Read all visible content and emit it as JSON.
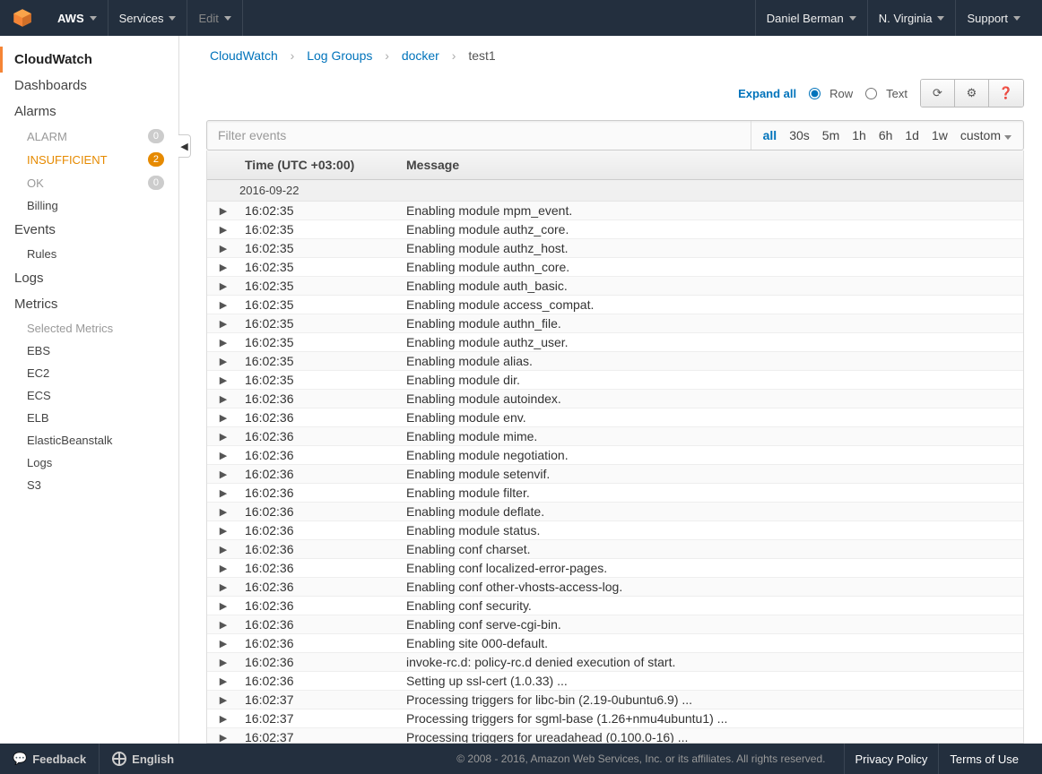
{
  "topnav": {
    "aws": "AWS",
    "services": "Services",
    "edit": "Edit",
    "user": "Daniel Berman",
    "region": "N. Virginia",
    "support": "Support"
  },
  "sidebar": {
    "cloudwatch": "CloudWatch",
    "dashboards": "Dashboards",
    "alarms": "Alarms",
    "alarm_sub": {
      "alarm": "ALARM",
      "alarm_count": "0",
      "insufficient": "INSUFFICIENT",
      "insufficient_count": "2",
      "ok": "OK",
      "ok_count": "0"
    },
    "billing": "Billing",
    "events": "Events",
    "rules": "Rules",
    "logs": "Logs",
    "metrics": "Metrics",
    "selected_metrics": "Selected Metrics",
    "metric_items": [
      "EBS",
      "EC2",
      "ECS",
      "ELB",
      "ElasticBeanstalk",
      "Logs",
      "S3"
    ]
  },
  "breadcrumb": {
    "l1": "CloudWatch",
    "l2": "Log Groups",
    "l3": "docker",
    "current": "test1"
  },
  "toolbar": {
    "expand_all": "Expand all",
    "row": "Row",
    "text": "Text"
  },
  "filter": {
    "placeholder": "Filter events",
    "ranges": [
      "all",
      "30s",
      "5m",
      "1h",
      "6h",
      "1d",
      "1w",
      "custom"
    ],
    "active": "all"
  },
  "table": {
    "col_time": "Time (UTC +03:00)",
    "col_msg": "Message",
    "date": "2016-09-22",
    "rows": [
      {
        "t": "16:02:35",
        "m": "Enabling module mpm_event."
      },
      {
        "t": "16:02:35",
        "m": "Enabling module authz_core."
      },
      {
        "t": "16:02:35",
        "m": "Enabling module authz_host."
      },
      {
        "t": "16:02:35",
        "m": "Enabling module authn_core."
      },
      {
        "t": "16:02:35",
        "m": "Enabling module auth_basic."
      },
      {
        "t": "16:02:35",
        "m": "Enabling module access_compat."
      },
      {
        "t": "16:02:35",
        "m": "Enabling module authn_file."
      },
      {
        "t": "16:02:35",
        "m": "Enabling module authz_user."
      },
      {
        "t": "16:02:35",
        "m": "Enabling module alias."
      },
      {
        "t": "16:02:35",
        "m": "Enabling module dir."
      },
      {
        "t": "16:02:36",
        "m": "Enabling module autoindex."
      },
      {
        "t": "16:02:36",
        "m": "Enabling module env."
      },
      {
        "t": "16:02:36",
        "m": "Enabling module mime."
      },
      {
        "t": "16:02:36",
        "m": "Enabling module negotiation."
      },
      {
        "t": "16:02:36",
        "m": "Enabling module setenvif."
      },
      {
        "t": "16:02:36",
        "m": "Enabling module filter."
      },
      {
        "t": "16:02:36",
        "m": "Enabling module deflate."
      },
      {
        "t": "16:02:36",
        "m": "Enabling module status."
      },
      {
        "t": "16:02:36",
        "m": "Enabling conf charset."
      },
      {
        "t": "16:02:36",
        "m": "Enabling conf localized-error-pages."
      },
      {
        "t": "16:02:36",
        "m": "Enabling conf other-vhosts-access-log."
      },
      {
        "t": "16:02:36",
        "m": "Enabling conf security."
      },
      {
        "t": "16:02:36",
        "m": "Enabling conf serve-cgi-bin."
      },
      {
        "t": "16:02:36",
        "m": "Enabling site 000-default."
      },
      {
        "t": "16:02:36",
        "m": "invoke-rc.d: policy-rc.d denied execution of start."
      },
      {
        "t": "16:02:36",
        "m": "Setting up ssl-cert (1.0.33) ..."
      },
      {
        "t": "16:02:37",
        "m": "Processing triggers for libc-bin (2.19-0ubuntu6.9) ..."
      },
      {
        "t": "16:02:37",
        "m": "Processing triggers for sgml-base (1.26+nmu4ubuntu1) ..."
      },
      {
        "t": "16:02:37",
        "m": "Processing triggers for ureadahead (0.100.0-16) ..."
      }
    ]
  },
  "footer": {
    "feedback": "Feedback",
    "language": "English",
    "copyright": "© 2008 - 2016, Amazon Web Services, Inc. or its affiliates. All rights reserved.",
    "privacy": "Privacy Policy",
    "terms": "Terms of Use"
  }
}
